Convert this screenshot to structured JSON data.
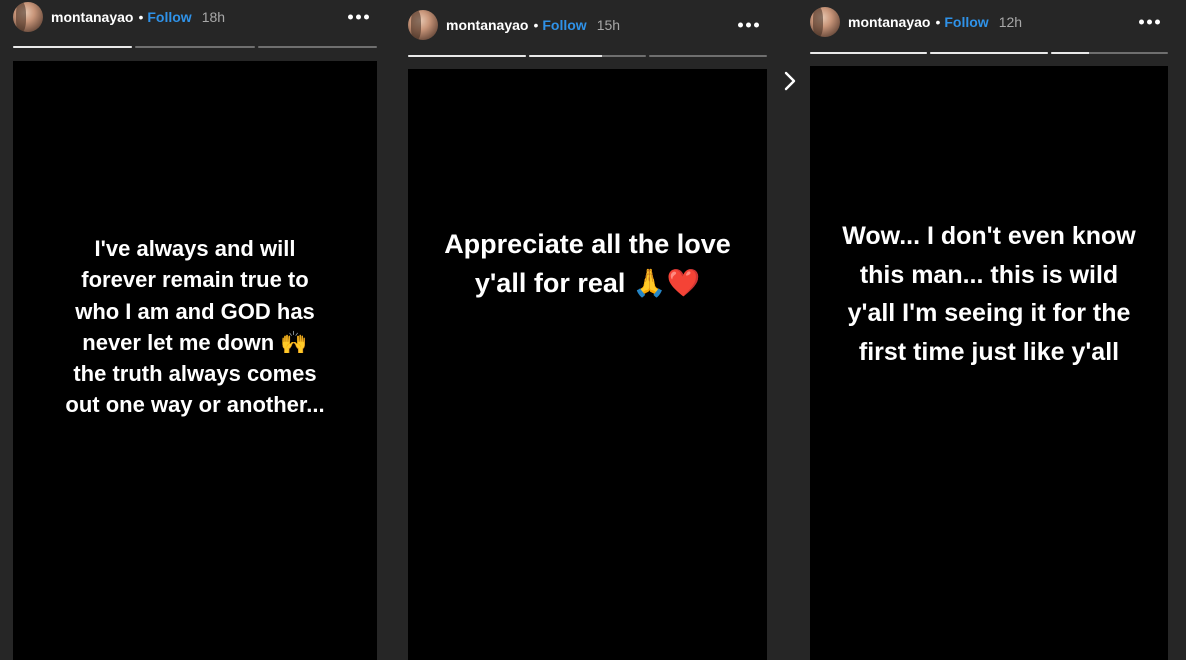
{
  "stories": [
    {
      "username": "montanayao",
      "separator": "•",
      "follow_label": "Follow",
      "time": "18h",
      "progress": [
        1.0,
        0.0,
        0.0
      ],
      "text": "I've always and will forever remain true to who I am and GOD has never let me down 🙌 the truth always comes out one way or another..."
    },
    {
      "username": "montanayao",
      "separator": "•",
      "follow_label": "Follow",
      "time": "15h",
      "progress": [
        1.0,
        0.62,
        0.0
      ],
      "text": "Appreciate all the love y'all for real 🙏❤️"
    },
    {
      "username": "montanayao",
      "separator": "•",
      "follow_label": "Follow",
      "time": "12h",
      "progress": [
        1.0,
        1.0,
        0.33
      ],
      "text": "Wow... I don't even know this man... this is wild y'all I'm seeing it for the first time just like y'all"
    }
  ],
  "icons": {
    "more": "more-options-icon",
    "next": "chevron-right-icon"
  }
}
